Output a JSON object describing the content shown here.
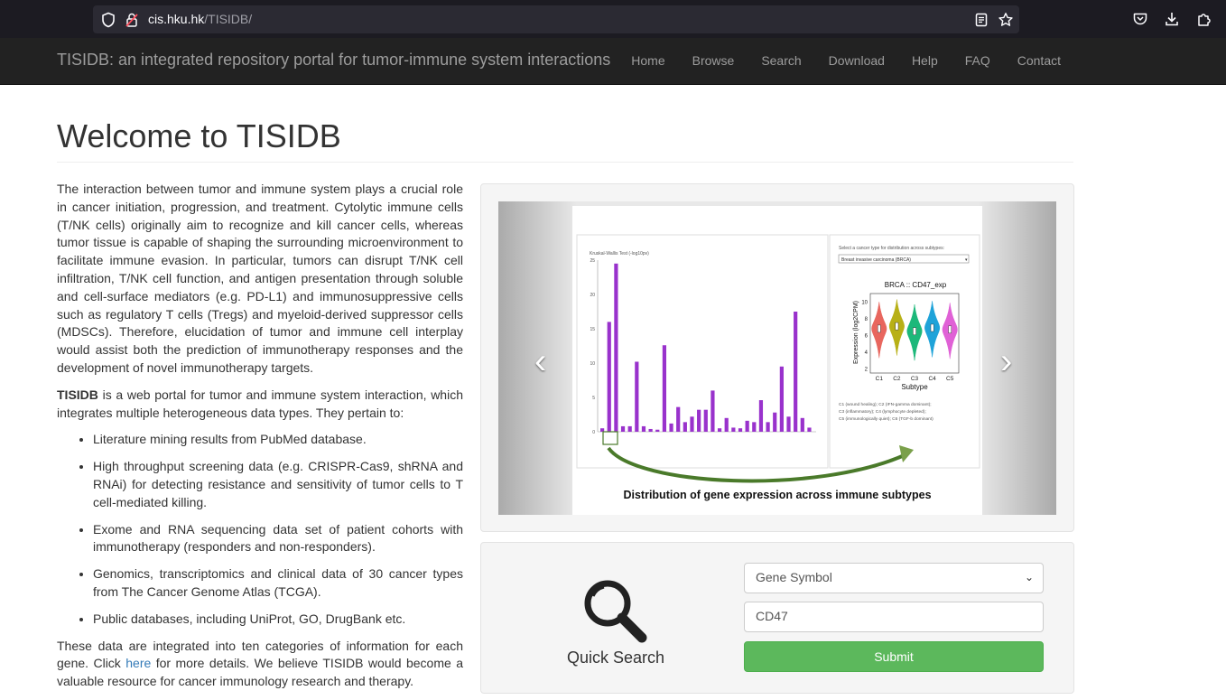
{
  "browser": {
    "url_host": "cis.hku.hk",
    "url_path": "/TISIDB/"
  },
  "navbar": {
    "brand": "TISIDB: an integrated repository portal for tumor-immune system interactions",
    "links": [
      "Home",
      "Browse",
      "Search",
      "Download",
      "Help",
      "FAQ",
      "Contact"
    ]
  },
  "page": {
    "title": "Welcome to TISIDB"
  },
  "intro": {
    "paragraph1": "The interaction between tumor and immune system plays a crucial role in cancer initiation, progression, and treatment. Cytolytic immune cells (T/NK cells) originally aim to recognize and kill cancer cells, whereas tumor tissue is capable of shaping the surrounding microenvironment to facilitate immune evasion. In particular, tumors can disrupt T/NK cell infiltration, T/NK cell function, and antigen presentation through soluble and cell-surface mediators (e.g. PD-L1) and immunosuppressive cells such as regulatory T cells (Tregs) and myeloid-derived suppressor cells (MDSCs). Therefore, elucidation of tumor and immune cell interplay would assist both the prediction of immunotherapy responses and the development of novel immunotherapy targets.",
    "p2_bold": "TISIDB",
    "p2_rest": " is a web portal for tumor and immune system interaction, which integrates multiple heterogeneous data types. They pertain to:",
    "bullets": [
      "Literature mining results from PubMed database.",
      "High throughput screening data (e.g. CRISPR-Cas9, shRNA and RNAi) for detecting resistance and sensitivity of tumor cells to T cell-mediated killing.",
      "Exome and RNA sequencing data set of patient cohorts with immunotherapy (responders and non-responders).",
      "Genomics, transcriptomics and clinical data of 30 cancer types from The Cancer Genome Atlas (TCGA).",
      "Public databases, including UniProt, GO, DrugBank etc."
    ],
    "p3_before": "These data are integrated into ten categories of information for each gene. Click ",
    "p3_link": "here",
    "p3_after": " for more details. We believe TISIDB would become a valuable resource for cancer immunology research and therapy."
  },
  "carousel": {
    "caption": "Distribution of gene expression across immune subtypes",
    "left_chart_label": "Kruskal-Wallis Test (-log10pv)",
    "left_yticks": [
      "25",
      "20",
      "15",
      "10",
      "5",
      "0"
    ],
    "left_values": [
      0.5,
      16,
      24.5,
      0.8,
      0.8,
      10.2,
      0.8,
      0.4,
      0.3,
      12.6,
      1.2,
      3.6,
      1.4,
      2.2,
      3.2,
      3.2,
      6,
      0.5,
      2,
      0.6,
      0.5,
      1.6,
      1.4,
      4.6,
      1.4,
      2.8,
      9.5,
      2.2,
      17.5,
      2,
      0.6
    ],
    "left_colors": {
      "bar": "#9932cc",
      "arrow": "#4a7a2a"
    },
    "right_prompt": "Select a cancer type for distribution across subtypes:",
    "right_select": "Breast invasive carcinoma (BRCA)",
    "violin_title": "BRCA :: CD47_exp",
    "violin_ylabel": "Expression (log2CPM)",
    "violin_xlabel": "Subtype",
    "violin_yticks": [
      "10",
      "8",
      "6",
      "4",
      "2"
    ],
    "violin_subtypes": [
      {
        "name": "C1",
        "color": "#e8665e",
        "median": 6.8
      },
      {
        "name": "C2",
        "color": "#b8b017",
        "median": 7.1
      },
      {
        "name": "C3",
        "color": "#1cb87a",
        "median": 6.5
      },
      {
        "name": "C4",
        "color": "#1fa3d9",
        "median": 6.9
      },
      {
        "name": "C5",
        "color": "#e061d6",
        "median": 6.7
      }
    ],
    "legend_lines": [
      "C1 (wound healing); C2 (IFN-gamma dominant);",
      "C3 (inflammatory); C4 (lymphocyte depleted);",
      "C5 (immunologically quiet); C6 (TGF-b dominant)"
    ]
  },
  "quick_search": {
    "label": "Quick Search",
    "select_value": "Gene Symbol",
    "input_value": "CD47",
    "submit_label": "Submit"
  }
}
